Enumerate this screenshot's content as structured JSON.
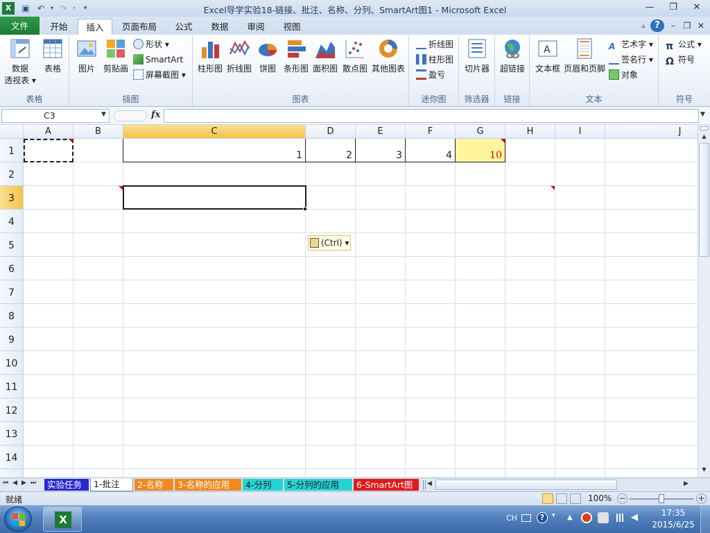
{
  "window": {
    "title": "Excel导学实验18-链接、批注、名称、分列、SmartArt图1 - Microsoft Excel",
    "minimize_glyph": "—",
    "restore_glyph": "❐",
    "close_glyph": "✕"
  },
  "tabs": [
    {
      "label": "文件"
    },
    {
      "label": "开始"
    },
    {
      "label": "插入"
    },
    {
      "label": "页面布局"
    },
    {
      "label": "公式"
    },
    {
      "label": "数据"
    },
    {
      "label": "审阅"
    },
    {
      "label": "视图"
    }
  ],
  "ribbon": {
    "groups": {
      "tables": {
        "label": "表格",
        "pivot_line1": "数据",
        "pivot_line2": "透视表 ▾",
        "table": "表格"
      },
      "illustrations": {
        "label": "插图",
        "picture": "图片",
        "clipart": "剪贴画",
        "shapes": "形状 ▾",
        "smartart": "SmartArt",
        "screenshot": "屏幕截图 ▾"
      },
      "charts": {
        "label": "图表",
        "column": "柱形图",
        "line": "折线图",
        "pie": "饼图",
        "bar": "条形图",
        "area": "面积图",
        "scatter": "散点图",
        "other": "其他图表"
      },
      "sparklines": {
        "label": "迷你图",
        "line": "折线图",
        "column": "柱形图",
        "winloss": "盈亏"
      },
      "filter": {
        "label": "筛选器",
        "slicer": "切片器"
      },
      "links": {
        "label": "链接",
        "hyperlink": "超链接"
      },
      "text": {
        "label": "文本",
        "textbox": "文本框",
        "headerfooter": "页眉和页脚",
        "wordart": "艺术字 ▾",
        "signature": "签名行 ▾",
        "object": "对象"
      },
      "symbols": {
        "label": "符号",
        "equation": "公式 ▾",
        "symbol": "符号"
      }
    }
  },
  "formula_bar": {
    "name_box": "C3",
    "fx": "fx",
    "value": ""
  },
  "columns": [
    "A",
    "B",
    "C",
    "D",
    "E",
    "F",
    "G",
    "H",
    "I",
    "J"
  ],
  "rows": [
    "1",
    "2",
    "3",
    "4",
    "5",
    "6",
    "7",
    "8",
    "9",
    "10",
    "11",
    "12",
    "13",
    "14"
  ],
  "cells": {
    "C1": "1",
    "D1": "2",
    "E1": "3",
    "F1": "4",
    "G1": "10"
  },
  "paste_options": "(Ctrl) ▾",
  "sheet_tabs": [
    {
      "label": "实验任务",
      "color": "#2828d0"
    },
    {
      "label": "1-批注",
      "color": "#ffffff"
    },
    {
      "label": "2-名称",
      "color": "#f08a1e"
    },
    {
      "label": "3-名称的应用",
      "color": "#f08a1e"
    },
    {
      "label": "4-分列",
      "color": "#26d3d3"
    },
    {
      "label": "5-分列的应用",
      "color": "#26d3d3"
    },
    {
      "label": "6-SmartArt图",
      "color": "#e01a1a"
    }
  ],
  "status": {
    "ready": "就绪",
    "zoom": "100%"
  },
  "taskbar": {
    "lang": "CH",
    "time": "17:35",
    "date": "2015/6/25"
  },
  "colors": {
    "accent_green": "#1c7a34",
    "selection_header": "#f4c24b",
    "highlight_cell": "#fff59d",
    "comment_red": "#d01010"
  }
}
